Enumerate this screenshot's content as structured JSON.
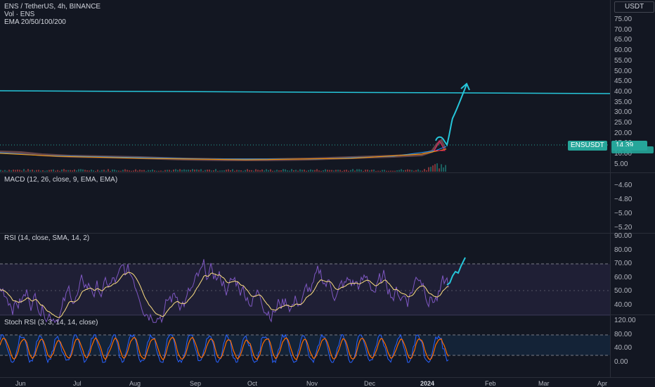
{
  "header": {
    "symbol_line": "ENS / TetherUS, 4h, BINANCE",
    "volume_line": "Vol · ENS",
    "ema_line": "EMA 20/50/100/200"
  },
  "price_axis": {
    "currency_badge": "USDT",
    "ticks": [
      "75.00",
      "70.00",
      "65.00",
      "60.00",
      "55.00",
      "50.00",
      "45.00",
      "40.00",
      "35.00",
      "30.00",
      "25.00",
      "20.00",
      "15.00",
      "10.00",
      "5.00"
    ],
    "price_label": "ENSUSDT",
    "price_value": "14.39"
  },
  "macd": {
    "legend": "MACD (12, 26, close, 9, EMA, EMA)",
    "ticks": [
      "−4.60",
      "−4.80",
      "−5.00",
      "−5.20"
    ]
  },
  "rsi": {
    "legend": "RSI (14, close, SMA, 14, 2)",
    "ticks": [
      "90.00",
      "80.00",
      "70.00",
      "60.00",
      "50.00",
      "40.00"
    ],
    "upper_band": 70,
    "lower_band": 30
  },
  "stoch": {
    "legend": "Stoch RSI (3, 3, 14, 14, close)",
    "ticks": [
      "120.00",
      "80.00",
      "40.00",
      "0.00"
    ],
    "upper_band": 80,
    "lower_band": 20
  },
  "time_axis": [
    "Jun",
    "Jul",
    "Aug",
    "Sep",
    "Oct",
    "Nov",
    "Dec",
    "2024",
    "Feb",
    "Mar",
    "Apr"
  ],
  "colors": {
    "bg": "#131722",
    "grid": "#2a2e39",
    "trend": "#26c6da",
    "rsi": "#7e57c2",
    "rsi_ma": "#ffe082",
    "stoch_k": "#2962ff",
    "stoch_d": "#ff6d00",
    "badge": "#26a69a"
  }
}
